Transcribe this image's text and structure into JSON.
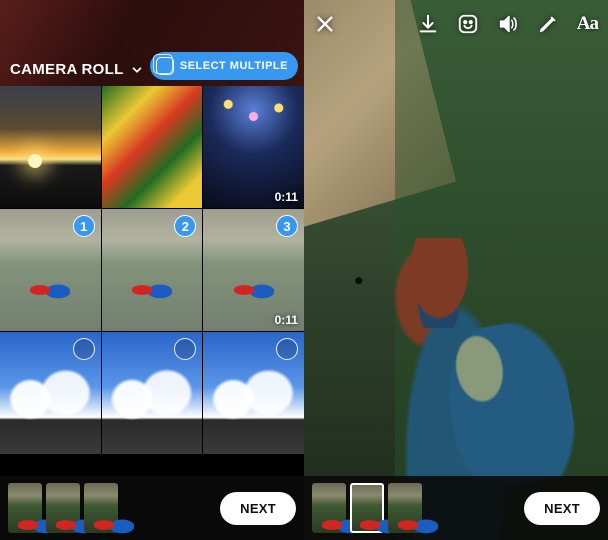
{
  "album": {
    "title": "CAMERA ROLL",
    "select_multiple_label": "SELECT MULTIPLE"
  },
  "grid": {
    "items": [
      {
        "kind": "photo",
        "scene": "sunset",
        "selected": false
      },
      {
        "kind": "photo",
        "scene": "parade",
        "selected": false
      },
      {
        "kind": "video",
        "scene": "crowd",
        "duration": "0:11",
        "selected": false
      },
      {
        "kind": "photo",
        "scene": "parrots1",
        "selected": true,
        "order": 1
      },
      {
        "kind": "photo",
        "scene": "parrots2",
        "selected": true,
        "order": 2
      },
      {
        "kind": "video",
        "scene": "parrots3",
        "duration": "0:11",
        "selected": true,
        "order": 3
      },
      {
        "kind": "photo",
        "scene": "sky",
        "selected": false,
        "show_empty_circle": true
      },
      {
        "kind": "photo",
        "scene": "sky",
        "selected": false,
        "show_empty_circle": true
      },
      {
        "kind": "photo",
        "scene": "sky",
        "selected": false,
        "show_empty_circle": true
      }
    ]
  },
  "left_tray": {
    "thumbs": [
      {
        "scene": "parrots1",
        "active": false
      },
      {
        "scene": "parrots2",
        "active": false
      },
      {
        "scene": "parrots3",
        "active": false
      }
    ],
    "next_label": "NEXT"
  },
  "right_tray": {
    "thumbs": [
      {
        "scene": "parrots1",
        "active": false
      },
      {
        "scene": "parrots2",
        "active": true
      },
      {
        "scene": "parrots3",
        "active": false
      }
    ],
    "next_label": "NEXT"
  },
  "editor": {
    "tools": {
      "close": "close-icon",
      "save": "download-icon",
      "sticker": "sticker-icon",
      "sound": "sound-icon",
      "draw": "draw-icon",
      "text": "Aa"
    }
  }
}
